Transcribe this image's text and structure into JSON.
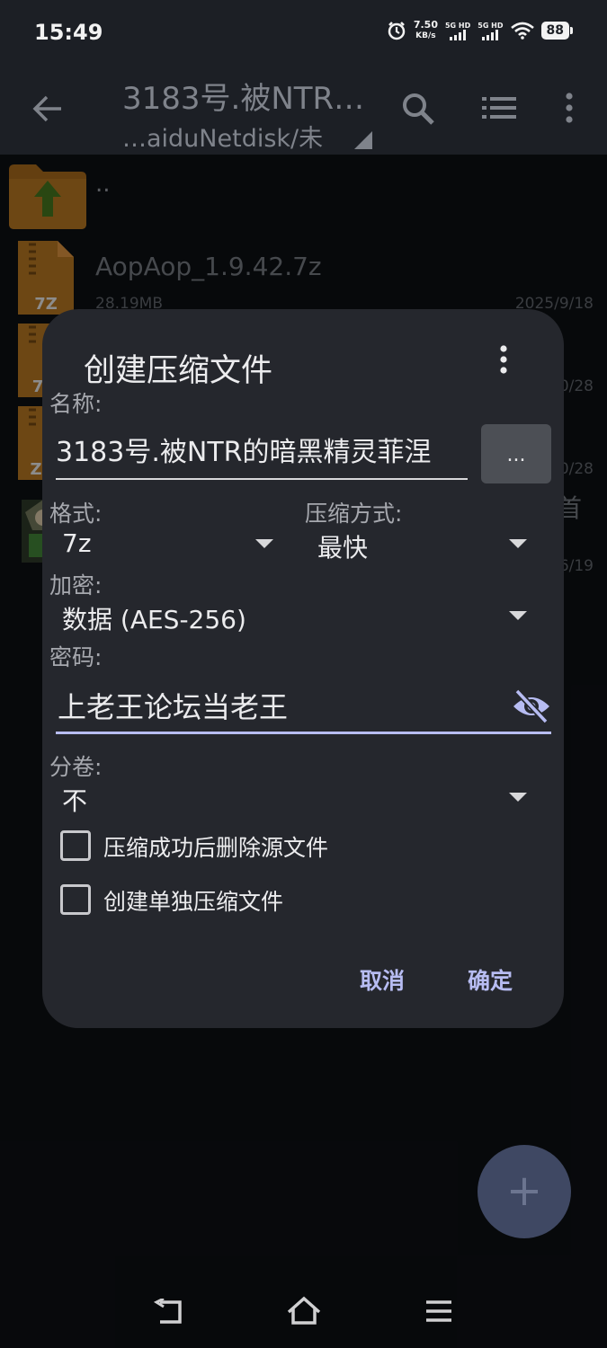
{
  "status_bar": {
    "time": "15:49",
    "net_speed_value": "7.50",
    "net_speed_unit": "KB/s",
    "sim1_label": "5G HD",
    "sim2_label": "5G HD",
    "battery": "88"
  },
  "app_bar": {
    "title": "3183号.被NTR…",
    "path": "…aiduNetdisk/未",
    "icons": [
      "back-arrow-icon",
      "search-icon",
      "list-view-icon",
      "more-vert-icon"
    ]
  },
  "file_list": {
    "parent_dir": "..",
    "items": [
      {
        "name": "AopAop_1.9.42.7z",
        "size": "28.19MB",
        "date": "2025/9/18",
        "icon_text": "7Z"
      },
      {
        "name": "",
        "size": "",
        "date": "0/28",
        "icon_text": "7"
      },
      {
        "name": "",
        "size": "",
        "date": "0/28",
        "icon_text": "Z"
      },
      {
        "name": "首",
        "size": "",
        "date": "6/19",
        "icon_text": ""
      }
    ]
  },
  "dialog": {
    "title": "创建压缩文件",
    "name_label": "名称:",
    "name_value": "3183号.被NTR的暗黑精灵菲涅",
    "browse_label": "...",
    "format_label": "格式:",
    "format_value": "7z",
    "method_label": "压缩方式:",
    "method_value": "最快",
    "encrypt_label": "加密:",
    "encrypt_value": "数据 (AES-256)",
    "password_label": "密码:",
    "password_value": "上老王论坛当老王",
    "volume_label": "分卷:",
    "volume_value": "不",
    "delete_source_label": "压缩成功后删除源文件",
    "delete_source_checked": false,
    "separate_archive_label": "创建单独压缩文件",
    "separate_archive_checked": false,
    "cancel_label": "取消",
    "ok_label": "确定",
    "accent_color": "#b7bcf2"
  },
  "fab": {
    "label": "+"
  },
  "nav_bar": {
    "icons": [
      "back-nav-icon",
      "home-nav-icon",
      "recents-nav-icon"
    ]
  }
}
